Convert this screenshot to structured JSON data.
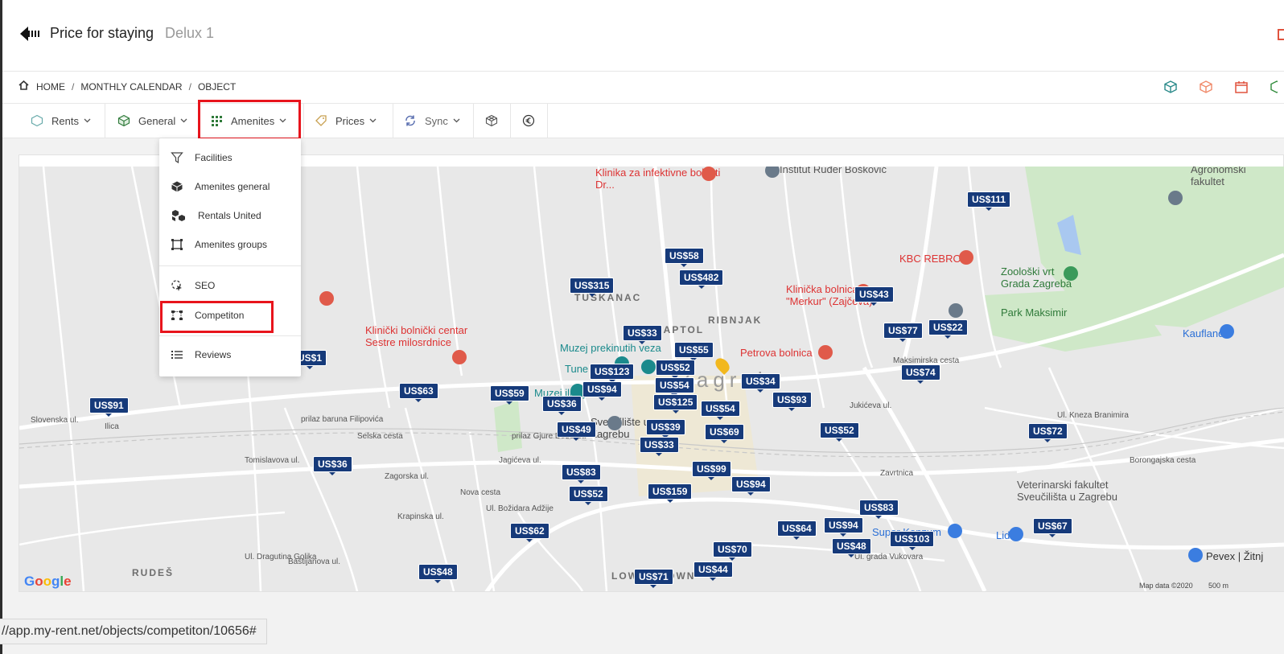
{
  "header": {
    "title": "Price for staying",
    "subtitle": "Delux 1"
  },
  "breadcrumb": [
    "HOME",
    "MONTHLY CALENDAR",
    "OBJECT"
  ],
  "tabs": [
    {
      "label": "Rents",
      "icon": "cube-outline-icon"
    },
    {
      "label": "General",
      "icon": "cube-icon"
    },
    {
      "label": "Amenites",
      "icon": "grid-icon"
    },
    {
      "label": "Prices",
      "icon": "tag-icon"
    },
    {
      "label": "Sync",
      "icon": "sync-icon"
    },
    {
      "label": "",
      "icon": "cube-3d-icon"
    },
    {
      "label": "",
      "icon": "euro-icon"
    }
  ],
  "dropdown": {
    "items": [
      {
        "label": "Facilities",
        "icon": "filter-icon"
      },
      {
        "label": "Amenites general",
        "icon": "box-icon"
      },
      {
        "label": "Rentals United",
        "icon": "boxes-icon"
      },
      {
        "label": "Amenites groups",
        "icon": "group-icon"
      },
      {
        "label": "SEO",
        "icon": "cursor-icon"
      },
      {
        "label": "Competiton",
        "icon": "network-icon"
      },
      {
        "label": "Reviews",
        "icon": "list-icon"
      }
    ]
  },
  "map": {
    "prices": [
      "US$111",
      "US$58",
      "US$482",
      "US$315",
      "US$43",
      "US$77",
      "US$22",
      "US$33",
      "US$55",
      "US$52",
      "US$123",
      "US$54",
      "US$34",
      "US$74",
      "US$94",
      "US$125",
      "US$93",
      "US$63",
      "US$59",
      "US$36",
      "US$91",
      "US$54",
      "US$49",
      "US$39",
      "US$69",
      "US$33",
      "US$52",
      "US$72",
      "US$36",
      "US$83",
      "US$99",
      "US$94",
      "US$52",
      "US$159",
      "US$83",
      "US$94",
      "US$64",
      "US$62",
      "US$103",
      "US$67",
      "US$48",
      "US$70",
      "US$44",
      "US$48",
      "US$71",
      "US$1"
    ],
    "places": [
      {
        "name": "Klinika za infektivne bolesti Dr...",
        "kind": "hospital"
      },
      {
        "name": "Institut Ruđer Bošković",
        "kind": "poi"
      },
      {
        "name": "KBC REBRO",
        "kind": "hospital"
      },
      {
        "name": "Zoološki vrt Grada Zagreba",
        "kind": "park"
      },
      {
        "name": "Park Maksimir",
        "kind": "park"
      },
      {
        "name": "Kaufland",
        "kind": "shop"
      },
      {
        "name": "Klinička bolnica \"Merkur\" (Zajčeva)",
        "kind": "hospital"
      },
      {
        "name": "Petrova bolnica",
        "kind": "hospital"
      },
      {
        "name": "Klinički bolnički centar Sestre milosrdnice",
        "kind": "hospital"
      },
      {
        "name": "Muzej prekinutih veza",
        "kind": "museum"
      },
      {
        "name": "Veterinarski fakultet Sveučilišta u Zagrebu",
        "kind": "poi"
      },
      {
        "name": "Lidl",
        "kind": "shop"
      },
      {
        "name": "Pevex | Žitnj",
        "kind": "shop"
      },
      {
        "name": "Agronomski fakultet",
        "kind": "poi"
      },
      {
        "name": "Sveučilište u Zagrebu",
        "kind": "poi"
      },
      {
        "name": "Super Konzum",
        "kind": "shop"
      },
      {
        "name": "Tune",
        "kind": "poi"
      },
      {
        "name": "Muzej iluzija",
        "kind": "museum"
      }
    ],
    "districts": [
      "TUŠKANAC",
      "KAPTOL",
      "RIBNJAK",
      "RUDEŠ",
      "LOWER TOWN",
      "Zagreb"
    ],
    "streets": [
      "prilaz baruna Filipovića",
      "Ilica",
      "Tomislavova ul.",
      "Maksimirska cesta",
      "Ul. Kneza Branimira",
      "Zagorska ul.",
      "Jagićeva ul.",
      "prilaz Gjure Deželića",
      "Ul. grada Vukovara",
      "Borongajska cesta",
      "Ul. Dragutina Golika",
      "Baštijanova ul.",
      "Nova cesta",
      "Selska cesta",
      "Zavrtnica",
      "Jukićeva ul.",
      "Ul. Božidara Adžije",
      "Krapinska ul.",
      "Slovenska ul."
    ],
    "attribution": "Map data ©2020",
    "scale": "500 m",
    "logo": "Google"
  },
  "status_url": "//app.my-rent.net/objects/competiton/10656#"
}
